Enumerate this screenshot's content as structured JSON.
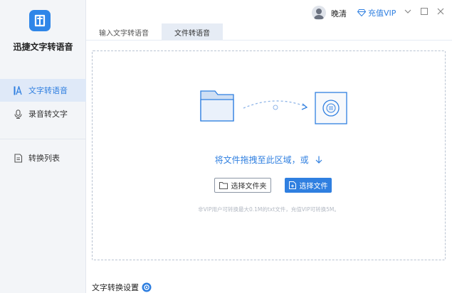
{
  "app": {
    "name": "迅捷文字转语音"
  },
  "sidebar": {
    "items": [
      {
        "label": "文字转语音",
        "icon": "text-a-icon",
        "active": true
      },
      {
        "label": "录音转文字",
        "icon": "microphone-icon",
        "active": false
      },
      {
        "label": "转换列表",
        "icon": "list-document-icon",
        "active": false
      }
    ]
  },
  "header": {
    "username": "晚清",
    "vip_label": "充值VIP"
  },
  "tabs": [
    {
      "label": "输入文字转语音",
      "active": false
    },
    {
      "label": "文件转语音",
      "active": true
    }
  ],
  "dropzone": {
    "prompt": "将文件拖拽至此区域，或",
    "select_folder_label": "选择文件夹",
    "select_file_label": "选择文件",
    "hint": "非VIP用户可转换最大0.1M的txt文件，充值VIP可转换5M。"
  },
  "footer": {
    "settings_label": "文字转换设置"
  },
  "colors": {
    "accent": "#2f7fe0",
    "sidebar_bg": "#f3f5f8",
    "active_item_bg": "#dfe9f8"
  }
}
